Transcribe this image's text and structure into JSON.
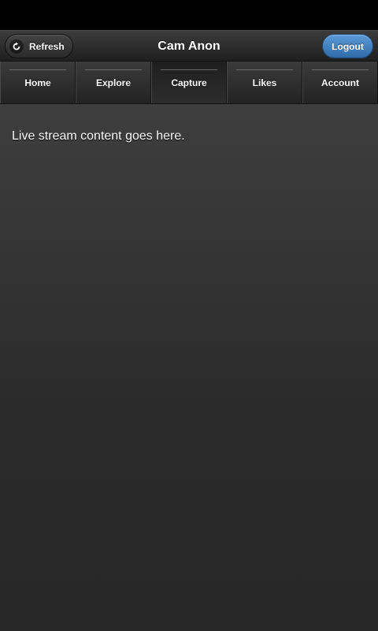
{
  "header": {
    "title": "Cam Anon",
    "refresh_label": "Refresh",
    "logout_label": "Logout"
  },
  "nav": {
    "items": [
      {
        "label": "Home"
      },
      {
        "label": "Explore"
      },
      {
        "label": "Capture"
      },
      {
        "label": "Likes"
      },
      {
        "label": "Account"
      }
    ],
    "active": "Capture"
  },
  "content": {
    "text": "Live stream content goes here."
  },
  "colors": {
    "logout_button": "#3f7fbf",
    "background": "#2f2f2f"
  }
}
